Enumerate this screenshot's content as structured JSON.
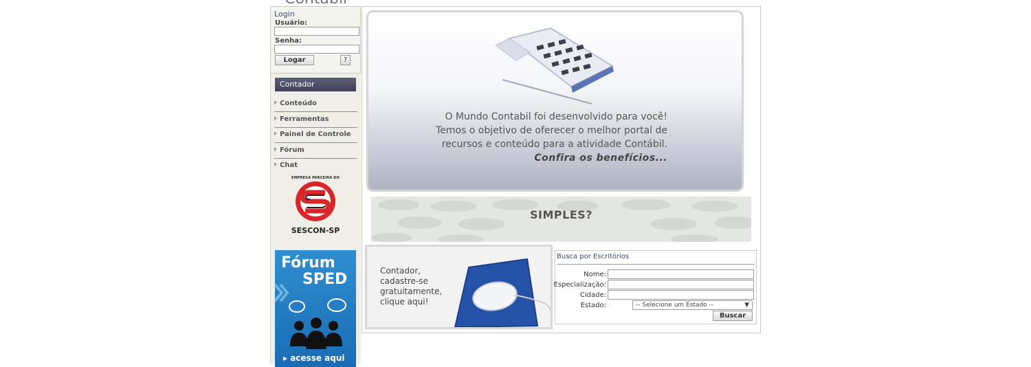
{
  "site": {
    "title": "Contabil"
  },
  "login": {
    "title": "Login",
    "user_label": "Usuário:",
    "user_value": "",
    "password_label": "Senha:",
    "password_value": "",
    "submit_label": "Logar",
    "help_label": "?"
  },
  "sidebar": {
    "header": "Contador",
    "items": [
      {
        "label": "Conteúdo"
      },
      {
        "label": "Ferramentas"
      },
      {
        "label": "Painel de Controle"
      },
      {
        "label": "Fórum"
      },
      {
        "label": "Chat"
      }
    ],
    "partner": {
      "caption": "EMPRESA PARCEIRA DO",
      "name": "SESCON-SP"
    },
    "forum_banner": {
      "line1": "Fórum",
      "line2": "SPED",
      "link": "▸ acesse aqui"
    }
  },
  "hero": {
    "line1": "O Mundo Contabil foi desenvolvido para você!",
    "line2": "Temos o objetivo de oferecer o melhor portal de",
    "line3": "recursos e conteúdo para a atividade Contábil.",
    "cta": "Confira os benefícios..."
  },
  "simples_banner": {
    "text": "SIMPLES?"
  },
  "signup_banner": {
    "line1": "Contador,",
    "line2": "cadastre-se",
    "line3": "gratuitamente,",
    "line4": "clique aqui!"
  },
  "office_search": {
    "title": "Busca por Escritórios",
    "name_label": "Nome:",
    "specialization_label": "Especialização:",
    "city_label": "Cidade:",
    "state_label": "Estado:",
    "state_value": "-- Selecione um Estado --",
    "submit_label": "Buscar"
  },
  "colors": {
    "sidebar_header_bg": "#4b4e66",
    "forum_banner_bg": "#2479c0",
    "sescon_red": "#d9262b",
    "mousepad_blue": "#2452a8"
  }
}
